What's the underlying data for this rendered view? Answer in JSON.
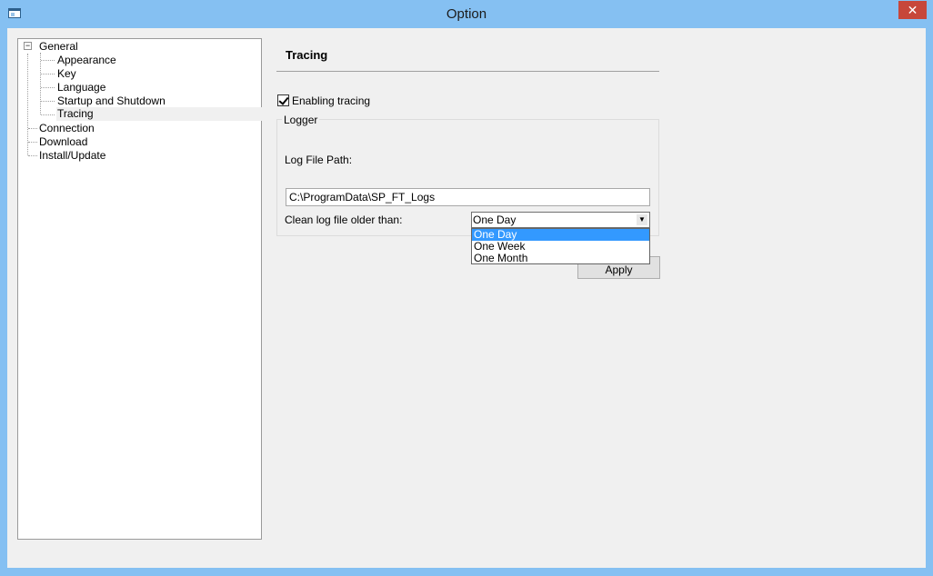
{
  "window": {
    "title": "Option",
    "close_label": "✕"
  },
  "tree": {
    "items": [
      {
        "label": "General",
        "expander": "−"
      },
      {
        "label": "Appearance"
      },
      {
        "label": "Key"
      },
      {
        "label": "Language"
      },
      {
        "label": "Startup and Shutdown"
      },
      {
        "label": "Tracing"
      },
      {
        "label": "Connection"
      },
      {
        "label": "Download"
      },
      {
        "label": "Install/Update"
      }
    ]
  },
  "panel": {
    "title": "Tracing",
    "enable_tracing": {
      "label": "Enabling tracing",
      "checked": true
    },
    "logger": {
      "legend": "Logger",
      "path_label": "Log File Path:",
      "path_value": "C:\\ProgramData\\SP_FT_Logs",
      "clean_label": "Clean log file older than:",
      "clean_selected": "One Day",
      "clean_options": [
        "One Day",
        "One Week",
        "One Month"
      ]
    },
    "apply_label": "Apply"
  }
}
